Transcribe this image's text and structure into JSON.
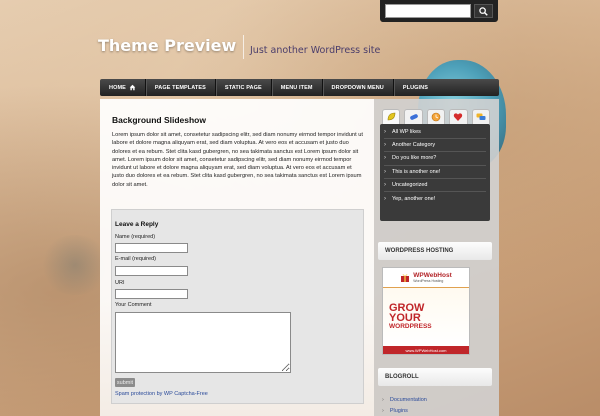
{
  "search": {
    "placeholder": ""
  },
  "header": {
    "title": "Theme Preview",
    "tagline": "Just another WordPress site"
  },
  "nav": {
    "items": [
      {
        "label": "HOME",
        "icon": "home-icon"
      },
      {
        "label": "PAGE TEMPLATES"
      },
      {
        "label": "STATIC PAGE"
      },
      {
        "label": "MENU ITEM"
      },
      {
        "label": "DROPDOWN MENU"
      },
      {
        "label": "PLUGINS"
      }
    ]
  },
  "post": {
    "title": "Background Slideshow",
    "body": "Lorem ipsum dolor sit amet, consetetur sadipscing elitr, sed diam nonumy eirmod tempor invidunt ut labore et dolore magna aliquyam erat, sed diam voluptua. At vero eos et accusam et justo duo dolores et ea rebum. Stet clita kasd gubergren, no sea takimata sanctus est Lorem ipsum dolor sit amet. Lorem ipsum dolor sit amet, consetetur sadipscing elitr, sed diam nonumy eirmod tempor invidunt ut labore et dolore magna aliquyam erat, sed diam voluptua. At vero eos et accusam et justo duo dolores et ea rebum. Stet clita kasd gubergren, no sea takimata sanctus est Lorem ipsum dolor sit amet."
  },
  "comment_form": {
    "title": "Leave a Reply",
    "name_label": "Name (required)",
    "email_label": "E-mail (required)",
    "uri_label": "URI",
    "comment_label": "Your Comment",
    "submit_label": "submit",
    "spam_note": "Spam protection by WP Captcha-Free"
  },
  "sidebar": {
    "tab_icons": [
      "leaf-icon",
      "pill-icon",
      "clock-icon",
      "heart-icon",
      "chat-icon"
    ],
    "tab_items": [
      "All WP likes",
      "Another Category",
      "Do you like more?",
      "This is another one!",
      "Uncategorized",
      "Yep, another one!"
    ],
    "hosting_heading": "WORDPRESS HOSTING",
    "ad": {
      "brand": "WPWebHost",
      "brand_sub": "WordPress Hosting",
      "line1": "GROW",
      "line2": "YOUR",
      "line3": "WORDPRESS",
      "footer": "www.WPWebHost.com"
    },
    "blogroll_heading": "BLOGROLL",
    "blogroll": [
      "Documentation",
      "Plugins"
    ]
  },
  "colors": {
    "nav_bg": "#2e2e2e",
    "tab_panel_bg": "#3a3a3a",
    "link": "#2a4a9a",
    "tagline": "#4a3d6b",
    "ad_red": "#c0262a"
  }
}
